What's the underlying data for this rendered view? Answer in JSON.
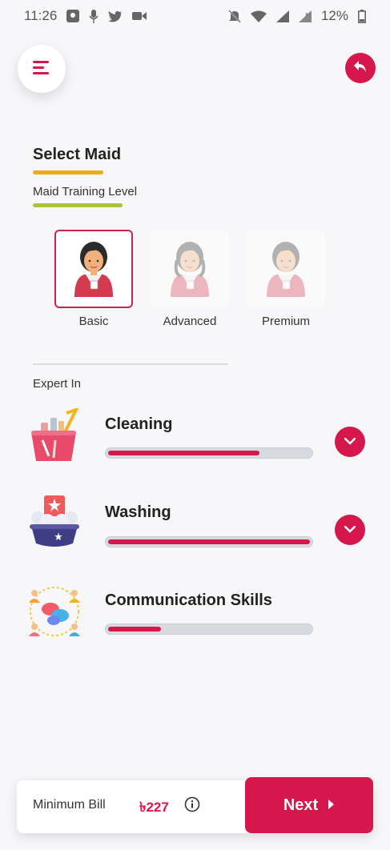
{
  "status_bar": {
    "time": "11:26",
    "battery": "12%"
  },
  "header": {
    "menu_icon": "hamburger-menu-icon",
    "back_icon": "reply-arrow-icon"
  },
  "page": {
    "title": "Select Maid",
    "subtitle": "Maid Training Level",
    "expert_label": "Expert In"
  },
  "levels": [
    {
      "label": "Basic",
      "selected": true
    },
    {
      "label": "Advanced",
      "selected": false
    },
    {
      "label": "Premium",
      "selected": false
    }
  ],
  "skills": [
    {
      "name": "Cleaning",
      "level": 0.75,
      "icon": "cleaning-bucket-icon",
      "expandable": true
    },
    {
      "name": "Washing",
      "level": 1.0,
      "icon": "washing-basin-icon",
      "expandable": true
    },
    {
      "name": "Communication Skills",
      "level": 0.26,
      "icon": "communication-people-icon",
      "expandable": false
    }
  ],
  "bottom_bar": {
    "bill_label": "Minimum Bill",
    "bill_value": "৳227",
    "next_label": "Next"
  },
  "colors": {
    "accent": "#d6174b",
    "title_underline": "#f2a81d",
    "subtitle_underline": "#a9c23c"
  }
}
